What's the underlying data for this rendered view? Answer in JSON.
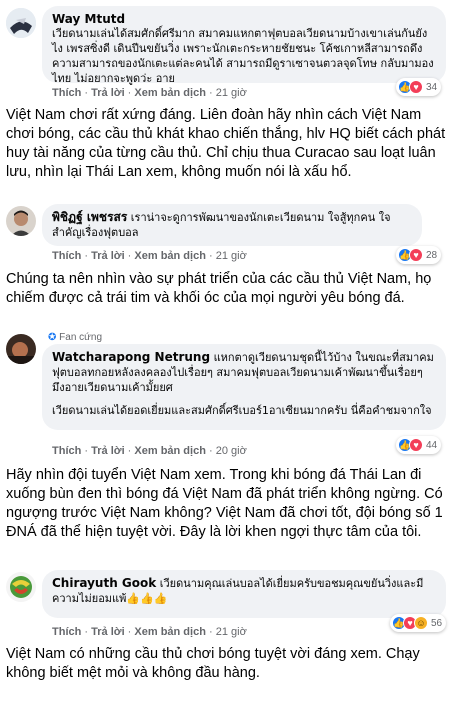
{
  "comments": [
    {
      "author": "Way Mtutd",
      "text": "เวียดนามเล่นได้สมศักดิ์ศรีมาก สมาคมแหกตาฟุตบอลเวียดนามบ้างเขาเล่นกันยังไง เพรสซิ่งดี เดินปีนขยันวิ่ง เพราะนักเตะกระหายชัยชนะ โค้ชเกาหลีสามารถดึงความสามารถของนักเตะแต่ละคนได้ สามารถมีดูราเซาจนตวลจุดโทษ กลับมามองไทย ไม่อยากจะพูดว่ะ อาย",
      "like": "Thích",
      "reply": "Trả lời",
      "translate": "Xem bản dịch",
      "time": "21 giờ",
      "reactions": "34",
      "caption": "Việt Nam chơi rất xứng đáng. Liên đoàn hãy nhìn cách Việt Nam chơi bóng, các cầu thủ khát khao chiến thắng, hlv HQ biết cách phát huy tài năng của từng cầu thủ. Chỉ chịu thua Curacao sau loạt luân lưu, nhìn lại Thái Lan xem, không muốn nói là xấu hổ."
    },
    {
      "author": "พิชิฏฐ์ เพชรสร",
      "text": "เราน่าจะดูการพัฒนาของนักเตะเวียดนาม ใจสู้ทุกคน ใจสำคัญเรื่องฟุตบอล",
      "like": "Thích",
      "reply": "Trả lời",
      "translate": "Xem bản dịch",
      "time": "21 giờ",
      "reactions": "28",
      "caption": "Chúng ta nên nhìn vào sự phát triển của các cầu thủ Việt Nam, họ chiếm được cả trái tim và khối óc của mọi người yêu bóng đá."
    },
    {
      "fan_label": "Fan cứng",
      "author": "Watcharapong Netrung",
      "text": "แหกตาดูเวียดนามชุดนี้ไว้บ้าง ในขณะที่สมาคมฟุตบอลทกอยหลังลงคลองไปเรื่อยๆ สมาคมฟุตบอลเวียดนามเค้าพัฒนาขึ้นเรื่อยๆ มึงอายเวียดนามเค้ามั้ยยศ",
      "text2": "เวียดนามเล่นได้ยอดเยี่ยมและสมศักดิ์ศรีเบอร์1อาเซียนมากครับ นี่คือคำชมจากใจ",
      "like": "Thích",
      "reply": "Trả lời",
      "translate": "Xem bản dịch",
      "time": "20 giờ",
      "reactions": "44",
      "caption": "Hãy nhìn đội tuyển Việt Nam xem. Trong khi bóng đá Thái Lan đi xuống bùn đen thì bóng đá Việt Nam đã phát triển không ngừng. Có ngượng trước Việt Nam không? Việt Nam đã chơi tốt, đội bóng số 1 ĐNÁ đã thể hiện tuyệt vời. Đây là lời khen ngợi thực tâm của tôi."
    },
    {
      "author": "Chirayuth Gook",
      "text": "เวียดนามคุณเล่นบอลได้เยี่ยมครับขอชมคุณขยันวิ่งและมีความไม่ยอมแพ้👍👍👍",
      "like": "Thích",
      "reply": "Trả lời",
      "translate": "Xem bản dịch",
      "time": "21 giờ",
      "reactions": "56",
      "caption": "Việt Nam có những cầu thủ chơi bóng tuyệt vời đáng xem. Chạy không biết mệt mỏi và không đầu hàng."
    }
  ]
}
